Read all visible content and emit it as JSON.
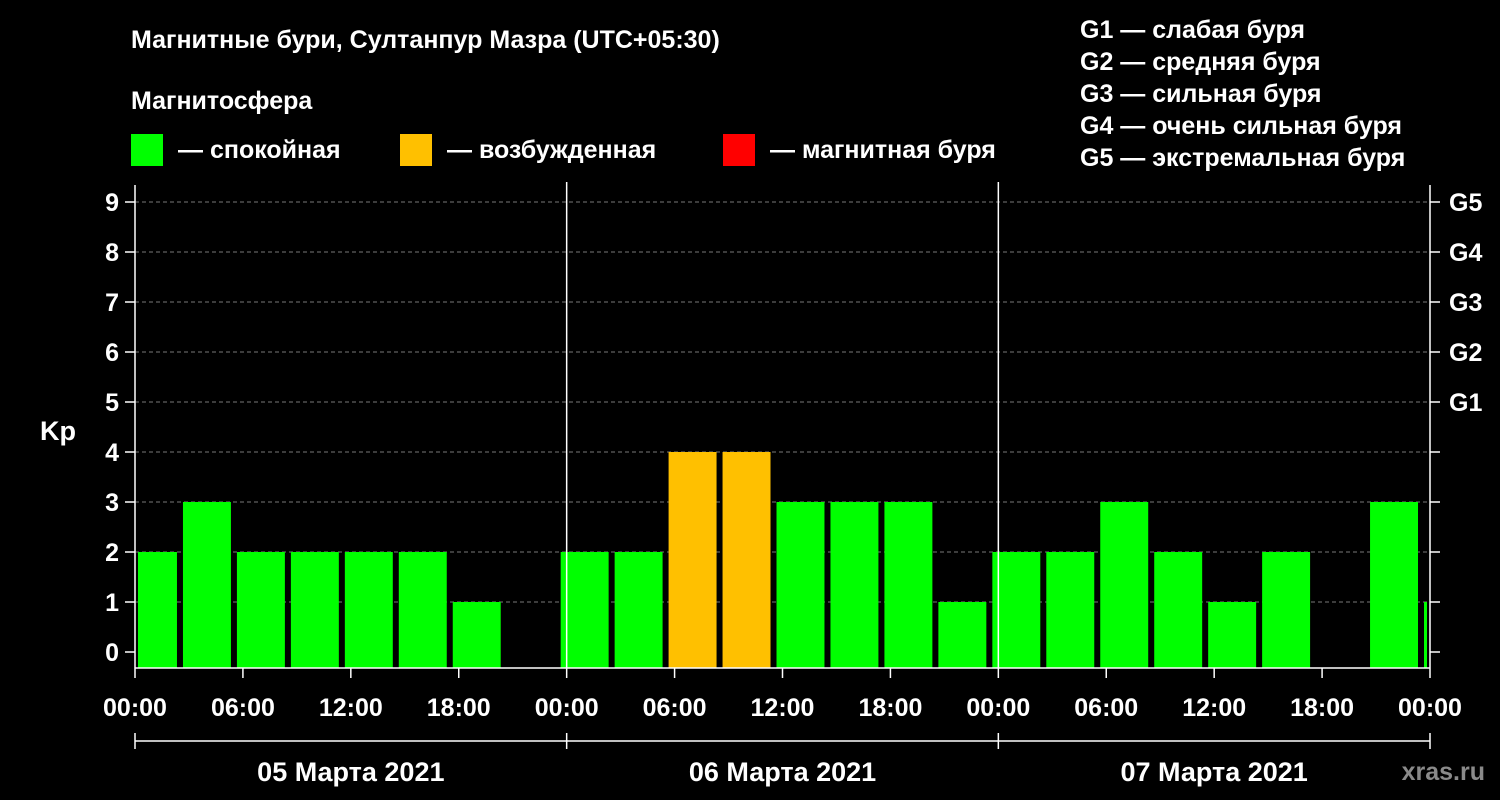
{
  "chart_data": {
    "type": "bar",
    "title": "Магнитные бури, Султанпур Мазра (UTC+05:30)",
    "legend": {
      "title": "Магнитосфера",
      "placement": "top-left",
      "items": [
        {
          "color": "#00ff00",
          "label": "— спокойная"
        },
        {
          "color": "#ffc000",
          "label": "— возбужденная"
        },
        {
          "color": "#ff0000",
          "label": "— магнитная буря"
        }
      ]
    },
    "g_scale": [
      "G1 — слабая буря",
      "G2 — средняя буря",
      "G3 — сильная буря",
      "G4 — очень сильная буря",
      "G5 — экстремальная буря"
    ],
    "ylabel": "Kp",
    "ylim": [
      0,
      9
    ],
    "y_ticks": [
      "0",
      "1",
      "2",
      "3",
      "4",
      "5",
      "6",
      "7",
      "8",
      "9"
    ],
    "right_ticks": [
      {
        "value": 5,
        "label": "G1"
      },
      {
        "value": 6,
        "label": "G2"
      },
      {
        "value": 7,
        "label": "G3"
      },
      {
        "value": 8,
        "label": "G4"
      },
      {
        "value": 9,
        "label": "G5"
      }
    ],
    "grid": "dashed horizontal",
    "x_tick_labels": [
      "00:00",
      "06:00",
      "12:00",
      "18:00",
      "00:00",
      "06:00",
      "12:00",
      "18:00",
      "00:00",
      "06:00",
      "12:00",
      "18:00",
      "00:00"
    ],
    "days": [
      "05 Марта 2021",
      "06 Марта 2021",
      "07 Марта 2021"
    ],
    "colors": {
      "quiet": "#00ff00",
      "unsettled": "#ffc000",
      "storm": "#ff0000"
    },
    "bars": [
      {
        "start": "05.03 00:00",
        "end": "05.03 02:30",
        "kp": 2,
        "level": "quiet"
      },
      {
        "start": "05.03 02:30",
        "end": "05.03 05:30",
        "kp": 3,
        "level": "quiet"
      },
      {
        "start": "05.03 05:30",
        "end": "05.03 08:30",
        "kp": 2,
        "level": "quiet"
      },
      {
        "start": "05.03 08:30",
        "end": "05.03 11:30",
        "kp": 2,
        "level": "quiet"
      },
      {
        "start": "05.03 11:30",
        "end": "05.03 14:30",
        "kp": 2,
        "level": "quiet"
      },
      {
        "start": "05.03 14:30",
        "end": "05.03 17:30",
        "kp": 2,
        "level": "quiet"
      },
      {
        "start": "05.03 17:30",
        "end": "05.03 20:30",
        "kp": 1,
        "level": "quiet"
      },
      {
        "start": "05.03 20:30",
        "end": "05.03 23:30",
        "kp": 0,
        "level": "quiet"
      },
      {
        "start": "05.03 23:30",
        "end": "06.03 02:30",
        "kp": 2,
        "level": "quiet"
      },
      {
        "start": "06.03 02:30",
        "end": "06.03 05:30",
        "kp": 2,
        "level": "quiet"
      },
      {
        "start": "06.03 05:30",
        "end": "06.03 08:30",
        "kp": 4,
        "level": "unsettled"
      },
      {
        "start": "06.03 08:30",
        "end": "06.03 11:30",
        "kp": 4,
        "level": "unsettled"
      },
      {
        "start": "06.03 11:30",
        "end": "06.03 14:30",
        "kp": 3,
        "level": "quiet"
      },
      {
        "start": "06.03 14:30",
        "end": "06.03 17:30",
        "kp": 3,
        "level": "quiet"
      },
      {
        "start": "06.03 17:30",
        "end": "06.03 20:30",
        "kp": 3,
        "level": "quiet"
      },
      {
        "start": "06.03 20:30",
        "end": "06.03 23:30",
        "kp": 1,
        "level": "quiet"
      },
      {
        "start": "06.03 23:30",
        "end": "07.03 02:30",
        "kp": 2,
        "level": "quiet"
      },
      {
        "start": "07.03 02:30",
        "end": "07.03 05:30",
        "kp": 2,
        "level": "quiet"
      },
      {
        "start": "07.03 05:30",
        "end": "07.03 08:30",
        "kp": 3,
        "level": "quiet"
      },
      {
        "start": "07.03 08:30",
        "end": "07.03 11:30",
        "kp": 2,
        "level": "quiet"
      },
      {
        "start": "07.03 11:30",
        "end": "07.03 14:30",
        "kp": 1,
        "level": "quiet"
      },
      {
        "start": "07.03 14:30",
        "end": "07.03 17:30",
        "kp": 2,
        "level": "quiet"
      },
      {
        "start": "07.03 17:30",
        "end": "07.03 20:30",
        "kp": 0,
        "level": "quiet"
      },
      {
        "start": "07.03 20:30",
        "end": "07.03 23:30",
        "kp": 3,
        "level": "quiet"
      },
      {
        "start": "07.03 23:30",
        "end": "08.03 00:00",
        "kp": 1,
        "level": "quiet"
      }
    ]
  },
  "watermark": "xras.ru"
}
